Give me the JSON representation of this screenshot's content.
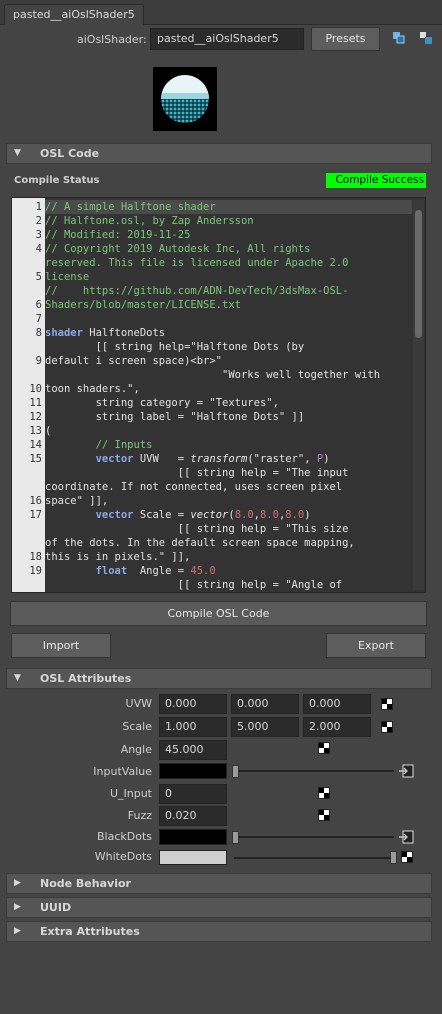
{
  "tab": {
    "label": "pasted__aiOslShader5"
  },
  "header": {
    "node_label": "aiOslShader:",
    "node_name": "pasted__aiOslShader5",
    "presets_label": "Presets",
    "icons": [
      "show-input-output-icon",
      "hide-icon"
    ]
  },
  "sections": {
    "osl_code": "OSL Code",
    "osl_attributes": "OSL Attributes",
    "node_behavior": "Node Behavior",
    "uuid": "UUID",
    "extra_attributes": "Extra Attributes"
  },
  "compile": {
    "status_label": "Compile Status",
    "status_value": "Compile Success",
    "status_color": "#00ff00",
    "compile_button": "Compile OSL Code",
    "import_button": "Import",
    "export_button": "Export"
  },
  "code": {
    "line_numbers": [
      "1",
      "2",
      "3",
      "4",
      "",
      "5",
      "",
      "6",
      "7",
      "8",
      "",
      "9",
      "",
      "10",
      "11",
      "12",
      "13",
      "14",
      "15",
      "",
      "",
      "16",
      "17",
      "",
      "",
      "18",
      "19"
    ],
    "lines": [
      "// A simple Halftone shader",
      "// Halftone.osl, by Zap Andersson",
      "// Modified: 2019-11-25",
      "// Copyright 2019 Autodesk Inc, All rights",
      "reserved. This file is licensed under Apache 2.0",
      "license",
      "//    https://github.com/ADN-DevTech/3dsMax-OSL-",
      "Shaders/blob/master/LICENSE.txt",
      "",
      "shader HalftoneDots",
      "        [[ string help=\"Halftone Dots (by",
      "default i screen space)<br>\"",
      "                            \"Works well together with",
      "toon shaders.\",",
      "        string category = \"Textures\",",
      "        string label = \"Halftone Dots\" ]]",
      "(",
      "        // Inputs",
      "        vector UVW   = transform(\"raster\", P)",
      "                     [[ string help = \"The input",
      "coordinate. If not connected, uses screen pixel",
      "space\" ]],",
      "        vector Scale = vector(8.0,8.0,8.0)",
      "                     [[ string help = \"This size",
      "of the dots. In the default screen space mapping,",
      "this is in pixels.\" ]],",
      "        float  Angle = 45.0",
      "                     [[ string help = \"Angle of"
    ]
  },
  "attributes": {
    "uvw": {
      "label": "UVW",
      "values": [
        "0.000",
        "0.000",
        "0.000"
      ]
    },
    "scale": {
      "label": "Scale",
      "values": [
        "1.000",
        "5.000",
        "2.000"
      ]
    },
    "angle": {
      "label": "Angle",
      "value": "45.000"
    },
    "input_value": {
      "label": "InputValue",
      "color": "#000000",
      "slider": 0.0
    },
    "u_input": {
      "label": "U_Input",
      "value": "0"
    },
    "fuzz": {
      "label": "Fuzz",
      "value": "0.020"
    },
    "black_dots": {
      "label": "BlackDots",
      "color": "#000000",
      "slider": 0.0
    },
    "white_dots": {
      "label": "WhiteDots",
      "color": "#cfcfcf",
      "slider": 1.0
    }
  }
}
